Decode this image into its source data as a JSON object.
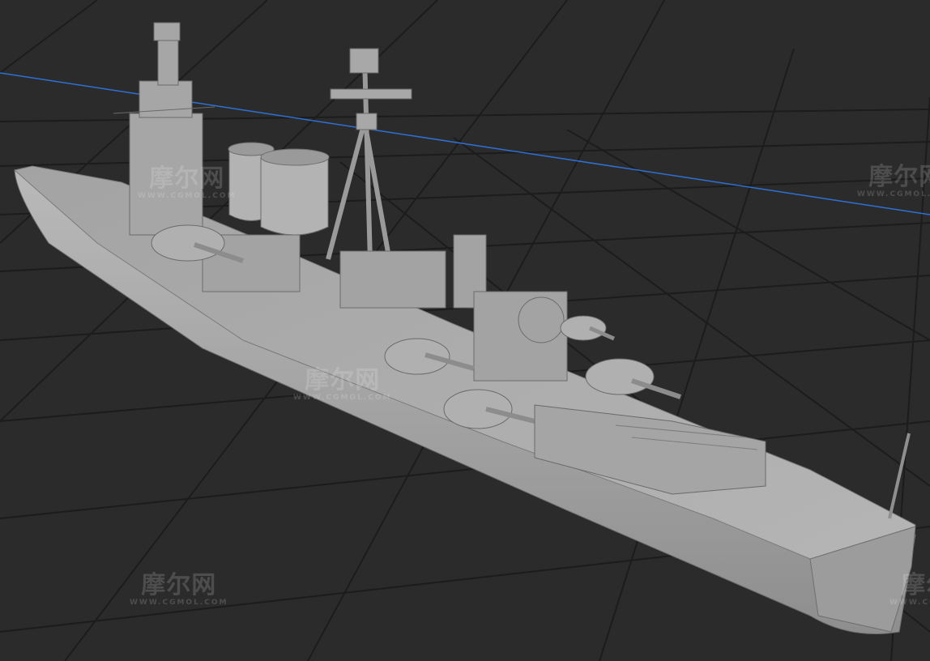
{
  "scene": {
    "description_free": true,
    "background_color": "#2b2b2b",
    "grid_color": "#1a1a1a",
    "axis_color": "#2f6fd6",
    "model_color": "#a9a9a9",
    "model_shadow": "#8a8a8a",
    "model_highlight": "#c2c2c2"
  },
  "watermarks": [
    {
      "text": "摩尔网",
      "url": "WWW.CGMOL.COM"
    },
    {
      "text": "摩尔网",
      "url": "WWW.CGMOL.COM"
    },
    {
      "text": "摩尔网",
      "url": "WWW.CGMOL.COM"
    },
    {
      "text": "摩尔网",
      "url": "WWW.CGMOL.COM"
    },
    {
      "text": "摩尔网",
      "url": "WWW.CGMOL.COM"
    }
  ]
}
